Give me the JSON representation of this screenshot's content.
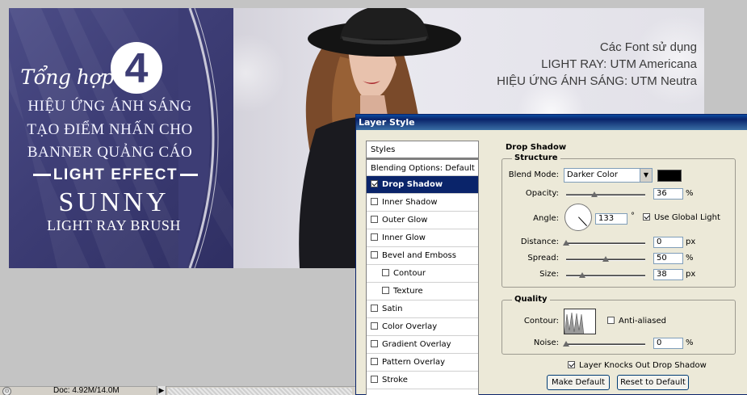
{
  "banner": {
    "tong_hop": "Tổng hợp",
    "number": "4",
    "line1": "HIỆU ỨNG ÁNH SÁNG",
    "line2": "TẠO ĐIỂM NHẤN CHO",
    "line3": "BANNER QUẢNG CÁO",
    "light_effect": "LIGHT EFFECT",
    "sunny": "SUNNY",
    "brush": "LIGHT RAY BRUSH",
    "fonts_title": "Các Font sử dụng",
    "font_line1": "LIGHT RAY: UTM Americana",
    "font_line2": "HIỆU ỨNG ÁNH SÁNG: UTM Neutra"
  },
  "statusbar": {
    "doc_info": "Doc: 4.92M/14.0M"
  },
  "dialog": {
    "title": "Layer Style",
    "styles_header": "Styles",
    "blending": "Blending Options: Default",
    "styles": [
      {
        "label": "Drop Shadow",
        "checked": true,
        "selected": true
      },
      {
        "label": "Inner Shadow",
        "checked": false
      },
      {
        "label": "Outer Glow",
        "checked": false
      },
      {
        "label": "Inner Glow",
        "checked": false
      },
      {
        "label": "Bevel and Emboss",
        "checked": false
      },
      {
        "label": "Contour",
        "checked": false,
        "sub": true
      },
      {
        "label": "Texture",
        "checked": false,
        "sub": true
      },
      {
        "label": "Satin",
        "checked": false
      },
      {
        "label": "Color Overlay",
        "checked": false
      },
      {
        "label": "Gradient Overlay",
        "checked": false
      },
      {
        "label": "Pattern Overlay",
        "checked": false
      },
      {
        "label": "Stroke",
        "checked": false
      }
    ],
    "drop_shadow_title": "Drop Shadow",
    "structure": {
      "label": "Structure",
      "blend_mode_label": "Blend Mode:",
      "blend_mode_value": "Darker Color",
      "shadow_color": "#000000",
      "opacity_label": "Opacity:",
      "opacity_value": "36",
      "opacity_unit": "%",
      "angle_label": "Angle:",
      "angle_value": "133",
      "angle_unit": "°",
      "use_global_light": "Use Global Light",
      "use_global_light_checked": true,
      "distance_label": "Distance:",
      "distance_value": "0",
      "distance_unit": "px",
      "spread_label": "Spread:",
      "spread_value": "50",
      "spread_unit": "%",
      "size_label": "Size:",
      "size_value": "38",
      "size_unit": "px"
    },
    "quality": {
      "label": "Quality",
      "contour_label": "Contour:",
      "anti_aliased": "Anti-aliased",
      "anti_aliased_checked": false,
      "noise_label": "Noise:",
      "noise_value": "0",
      "noise_unit": "%"
    },
    "knockout_label": "Layer Knocks Out Drop Shadow",
    "knockout_checked": true,
    "make_default": "Make Default",
    "reset_default": "Reset to Default"
  }
}
